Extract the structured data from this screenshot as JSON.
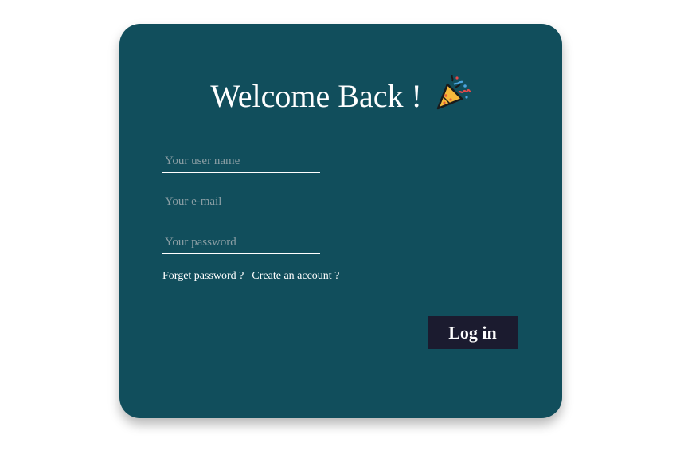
{
  "form": {
    "title": "Welcome Back !",
    "title_icon": "party-popper-icon",
    "username": {
      "value": "",
      "placeholder": "Your user name"
    },
    "email": {
      "value": "",
      "placeholder": "Your e-mail"
    },
    "password": {
      "value": "",
      "placeholder": "Your password"
    },
    "forget_password_label": "Forget password ?",
    "create_account_label": "Create an account ?",
    "login_label": "Log in"
  },
  "colors": {
    "card_background": "#114e5c",
    "button_background": "#1b1b2f",
    "text": "#ffffff",
    "placeholder": "#8a9ea4"
  }
}
